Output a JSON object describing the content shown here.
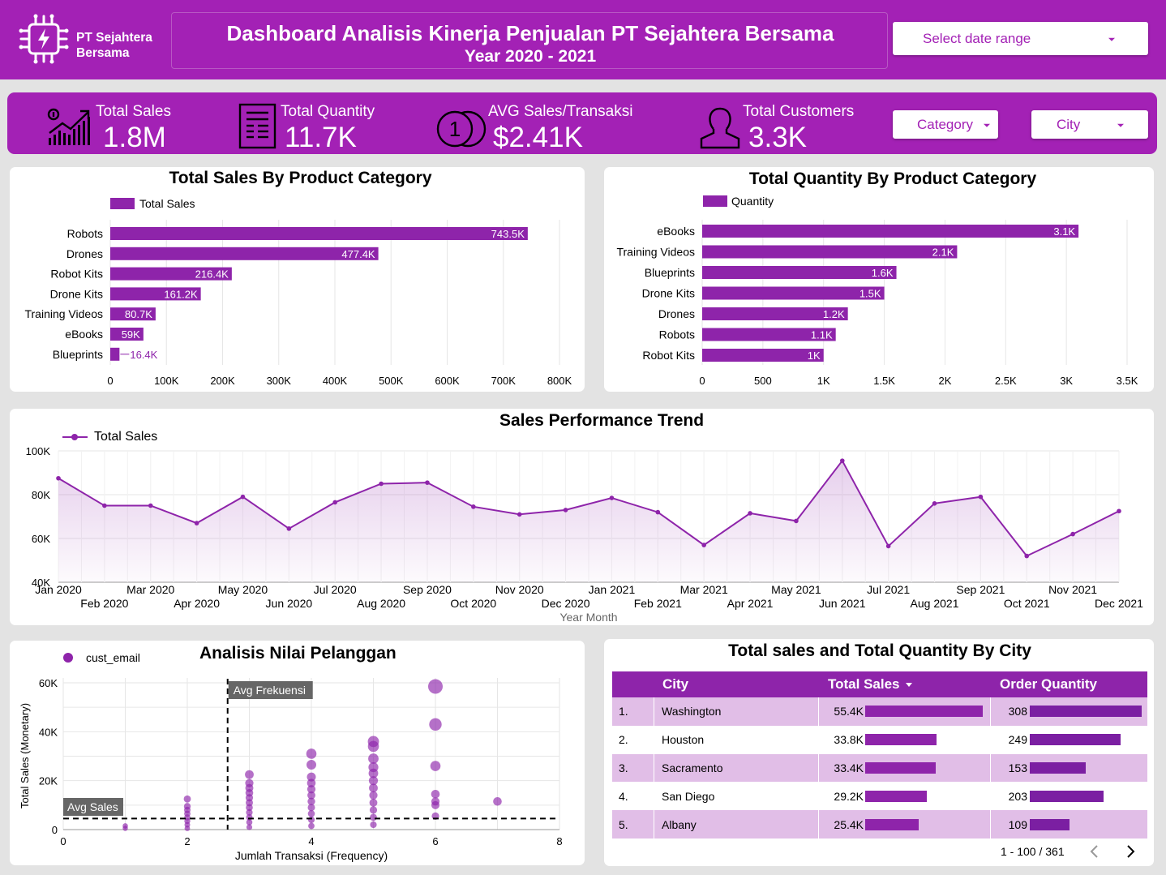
{
  "header": {
    "company": "PT Sejahtera Bersama",
    "company_line1": "PT Sejahtera",
    "company_line2": "Bersama",
    "title": "Dashboard Analisis Kinerja Penjualan PT Sejahtera Bersama",
    "subtitle": "Year 2020 - 2021",
    "date_range_placeholder": "Select date range"
  },
  "kpis": [
    {
      "label": "Total Sales",
      "value": "1.8M",
      "icon": "growth-chart-icon"
    },
    {
      "label": "Total Quantity",
      "value": "11.7K",
      "icon": "document-list-icon"
    },
    {
      "label": "AVG Sales/Transaksi",
      "value": "$2.41K",
      "icon": "coins-icon"
    },
    {
      "label": "Total Customers",
      "value": "3.3K",
      "icon": "person-icon"
    }
  ],
  "filters": {
    "category": "Category",
    "city": "City"
  },
  "colors": {
    "brand": "#a321b5",
    "bar": "#8e24aa",
    "table_header": "#8e24aa",
    "row_alt": "#e1bee7"
  },
  "chart_data": [
    {
      "type": "bar",
      "orientation": "horizontal",
      "title": "Total Sales By Product Category",
      "legend": "Total Sales",
      "categories": [
        "Robots",
        "Drones",
        "Robot Kits",
        "Drone Kits",
        "Training Videos",
        "eBooks",
        "Blueprints"
      ],
      "values": [
        743500,
        477400,
        216400,
        161200,
        80700,
        59000,
        16400
      ],
      "labels": [
        "743.5K",
        "477.4K",
        "216.4K",
        "161.2K",
        "80.7K",
        "59K",
        "16.4K"
      ],
      "xlim": [
        0,
        800000
      ],
      "ticks": [
        "0",
        "100K",
        "200K",
        "300K",
        "400K",
        "500K",
        "600K",
        "700K",
        "800K"
      ],
      "legend_position": "top-left",
      "grid": true
    },
    {
      "type": "bar",
      "orientation": "horizontal",
      "title": "Total Quantity By Product Category",
      "legend": "Quantity",
      "categories": [
        "eBooks",
        "Training Videos",
        "Blueprints",
        "Drone Kits",
        "Drones",
        "Robots",
        "Robot Kits"
      ],
      "values": [
        3100,
        2100,
        1600,
        1500,
        1200,
        1100,
        1000
      ],
      "labels": [
        "3.1K",
        "2.1K",
        "1.6K",
        "1.5K",
        "1.2K",
        "1.1K",
        "1K"
      ],
      "xlim": [
        0,
        3500
      ],
      "ticks": [
        "0",
        "500",
        "1K",
        "1.5K",
        "2K",
        "2.5K",
        "3K",
        "3.5K"
      ],
      "legend_position": "top-left",
      "grid": true
    },
    {
      "type": "area",
      "title": "Sales Performance Trend",
      "legend": "Total Sales",
      "xlabel": "Year Month",
      "x": [
        "Jan 2020",
        "Feb 2020",
        "Mar 2020",
        "Apr 2020",
        "May 2020",
        "Jun 2020",
        "Jul 2020",
        "Aug 2020",
        "Sep 2020",
        "Oct 2020",
        "Nov 2020",
        "Dec 2020",
        "Jan 2021",
        "Feb 2021",
        "Mar 2021",
        "Apr 2021",
        "May 2021",
        "Jun 2021",
        "Jul 2021",
        "Aug 2021",
        "Sep 2021",
        "Oct 2021",
        "Nov 2021",
        "Dec 2021"
      ],
      "values": [
        87500,
        75000,
        75000,
        67000,
        79000,
        64500,
        76500,
        85000,
        85500,
        74500,
        71000,
        73000,
        78500,
        72000,
        57000,
        71500,
        68000,
        95500,
        56500,
        76000,
        79000,
        52000,
        62000,
        72500
      ],
      "ylim": [
        40000,
        100000
      ],
      "ticks": [
        "40K",
        "60K",
        "80K",
        "100K"
      ],
      "legend_position": "top-left",
      "grid": true
    },
    {
      "type": "scatter",
      "title": "Analisis Nilai Pelanggan",
      "legend": "cust_email",
      "xlabel": "Jumlah Transaksi (Frequency)",
      "ylabel": "Total Sales (Monetary)",
      "xlim": [
        0,
        8
      ],
      "ylim": [
        0,
        60000
      ],
      "xticks": [
        "0",
        "2",
        "4",
        "6",
        "8"
      ],
      "yticks": [
        "0",
        "20K",
        "40K",
        "60K"
      ],
      "reference_lines": [
        {
          "label": "Avg Frekuensi",
          "axis": "x",
          "value": 2.65
        },
        {
          "label": "Avg Sales",
          "axis": "y",
          "value": 4500
        }
      ],
      "points": [
        {
          "x": 1,
          "y": 500
        },
        {
          "x": 1,
          "y": 1500
        },
        {
          "x": 2,
          "y": 500
        },
        {
          "x": 2,
          "y": 2000
        },
        {
          "x": 2,
          "y": 3500
        },
        {
          "x": 2,
          "y": 5000
        },
        {
          "x": 2,
          "y": 6500
        },
        {
          "x": 2,
          "y": 8000
        },
        {
          "x": 2,
          "y": 9500
        },
        {
          "x": 2,
          "y": 12500
        },
        {
          "x": 3,
          "y": 1000
        },
        {
          "x": 3,
          "y": 3000
        },
        {
          "x": 3,
          "y": 5000
        },
        {
          "x": 3,
          "y": 7000
        },
        {
          "x": 3,
          "y": 9000
        },
        {
          "x": 3,
          "y": 11000
        },
        {
          "x": 3,
          "y": 13000
        },
        {
          "x": 3,
          "y": 15000
        },
        {
          "x": 3,
          "y": 17000
        },
        {
          "x": 3,
          "y": 19000
        },
        {
          "x": 3,
          "y": 22500
        },
        {
          "x": 4,
          "y": 1500
        },
        {
          "x": 4,
          "y": 4000
        },
        {
          "x": 4,
          "y": 6500
        },
        {
          "x": 4,
          "y": 9000
        },
        {
          "x": 4,
          "y": 11500
        },
        {
          "x": 4,
          "y": 14000
        },
        {
          "x": 4,
          "y": 16500
        },
        {
          "x": 4,
          "y": 19000
        },
        {
          "x": 4,
          "y": 21500
        },
        {
          "x": 4,
          "y": 26500
        },
        {
          "x": 4,
          "y": 31000
        },
        {
          "x": 5,
          "y": 2000
        },
        {
          "x": 5,
          "y": 5000
        },
        {
          "x": 5,
          "y": 8000
        },
        {
          "x": 5,
          "y": 11000
        },
        {
          "x": 5,
          "y": 14000
        },
        {
          "x": 5,
          "y": 17000
        },
        {
          "x": 5,
          "y": 20000
        },
        {
          "x": 5,
          "y": 23000
        },
        {
          "x": 5,
          "y": 25500
        },
        {
          "x": 5,
          "y": 29000
        },
        {
          "x": 5,
          "y": 34000
        },
        {
          "x": 5,
          "y": 36000
        },
        {
          "x": 6,
          "y": 5500
        },
        {
          "x": 6,
          "y": 10000
        },
        {
          "x": 6,
          "y": 11500
        },
        {
          "x": 6,
          "y": 14500
        },
        {
          "x": 6,
          "y": 26000
        },
        {
          "x": 6,
          "y": 43000
        },
        {
          "x": 6,
          "y": 58500
        },
        {
          "x": 7,
          "y": 11500
        }
      ]
    },
    {
      "type": "table",
      "title": "Total sales and Total Quantity By City",
      "columns": [
        "City",
        "Total Sales",
        "Order Quantity"
      ],
      "rows": [
        {
          "rank": "1.",
          "city": "Washington",
          "sales": "55.4K",
          "sales_value": 55400,
          "qty": "308",
          "qty_value": 308
        },
        {
          "rank": "2.",
          "city": "Houston",
          "sales": "33.8K",
          "sales_value": 33800,
          "qty": "249",
          "qty_value": 249
        },
        {
          "rank": "3.",
          "city": "Sacramento",
          "sales": "33.4K",
          "sales_value": 33400,
          "qty": "153",
          "qty_value": 153
        },
        {
          "rank": "4.",
          "city": "San Diego",
          "sales": "29.2K",
          "sales_value": 29200,
          "qty": "203",
          "qty_value": 203
        },
        {
          "rank": "5.",
          "city": "Albany",
          "sales": "25.4K",
          "sales_value": 25400,
          "qty": "109",
          "qty_value": 109
        }
      ],
      "pagination": "1 - 100 / 361"
    }
  ]
}
